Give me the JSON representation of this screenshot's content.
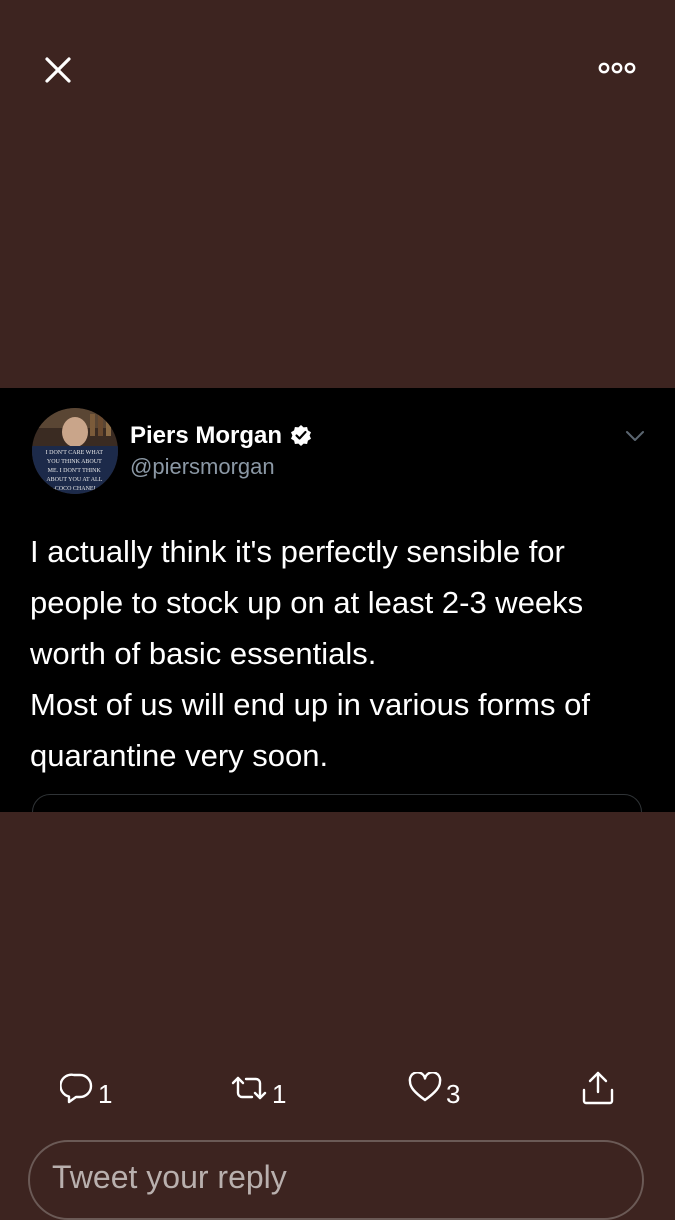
{
  "topbar": {
    "close_icon": "close-icon",
    "more_icon": "more-horizontal-icon"
  },
  "tweet": {
    "author_name": "Piers Morgan",
    "handle": "@piersmorgan",
    "verified": true,
    "avatar_caption": [
      "I DON'T CARE WHAT",
      "YOU THINK ABOUT",
      "ME. I DON'T THINK",
      "ABOUT YOU AT ALL",
      "-COCO CHANEL"
    ],
    "text_lines": [
      "I actually think it's perfectly sensible for",
      "people to stock up on at least 2-3 weeks",
      "worth of basic essentials.",
      "Most of us will end up in various forms of",
      "quarantine very soon."
    ]
  },
  "actions": {
    "reply_count": "1",
    "retweet_count": "1",
    "like_count": "3"
  },
  "reply": {
    "placeholder": "Tweet your reply"
  },
  "colors": {
    "background": "#3d2420",
    "card": "#000000",
    "secondary_text": "#8b98a5"
  }
}
